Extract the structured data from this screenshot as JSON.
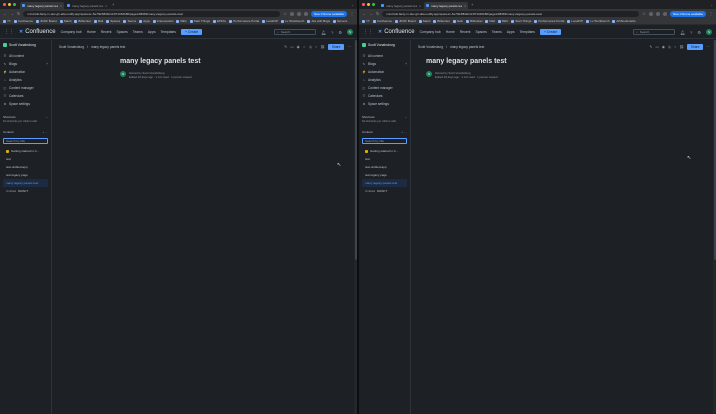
{
  "browser": {
    "tabs": [
      {
        "label": "many legacy panels test - C",
        "active": true
      },
      {
        "label": "many legacy panels test - C",
        "active": false
      }
    ],
    "new_tab_glyph": "+",
    "url": "mzuzwkl-facty-rv-dev-gh-atla.netlify.app/spaces/~5e7f9c8849c113f71040b80/pages/98369/many+legacy+panels+test",
    "new_chrome_label": "New Chrome available",
    "bookmarks": [
      "YT",
      "Confluence",
      "JDOF Board",
      "Stash",
      "Bitbucket",
      "Mail",
      "Spaces",
      "Teams",
      "Apps",
      "Frameworks",
      "REC",
      "Start Things",
      "EPFAL",
      "Performance Portal",
      "Local/VP",
      "Lv Workbench",
      "Jira with Bugs",
      "Servers"
    ],
    "bookmarks_right": [
      "Bitbucket",
      "hello",
      "All Bookmarks"
    ],
    "traffic": [
      "#ff5f57",
      "#febc2e",
      "#28c840"
    ]
  },
  "confluence": {
    "brand": "Confluence",
    "nav": [
      "Company hub",
      "Home",
      "Recent",
      "Spaces",
      "Teams",
      "Apps",
      "Templates"
    ],
    "create_label": "+ Create",
    "search_placeholder": "Search",
    "avatar_initial": "S"
  },
  "sidebar": {
    "space_name": "Scott Vonahsburg",
    "items": [
      {
        "icon": "☰",
        "label": "All content"
      },
      {
        "icon": "✎",
        "label": "Blogs",
        "plus": "+"
      },
      {
        "icon": "⚡",
        "label": "Automation"
      },
      {
        "icon": "⌁",
        "label": "Analytics"
      },
      {
        "icon": "◫",
        "label": "Content manager"
      },
      {
        "icon": "☷",
        "label": "Calendars"
      },
      {
        "icon": "⚙",
        "label": "Space settings"
      }
    ],
    "shortcuts_label": "Shortcuts",
    "shortcuts_note": "No shortcuts yet. Click to add",
    "content_label": "Content",
    "content_tools": "+ ···",
    "search_placeholder": "Search by title",
    "tree": [
      {
        "label": "Getting started in C...",
        "emoji": true,
        "active": false
      },
      {
        "label": "test",
        "emoji": false,
        "active": false
      },
      {
        "label": "test-untitled-app",
        "emoji": false,
        "active": false
      },
      {
        "label": "test legacy page",
        "emoji": false,
        "active": false
      },
      {
        "label": "many legacy panels test",
        "emoji": false,
        "active": true
      },
      {
        "label": "Untitled",
        "suffix": "DRAFT",
        "emoji": false,
        "active": false
      }
    ]
  },
  "page": {
    "breadcrumb_space": "Scott Vonahsburg",
    "breadcrumb_sep": "/",
    "breadcrumb_page": "many legacy panels test",
    "publish_label": "Share",
    "title": "many legacy panels test",
    "owner_avatar": "S",
    "owner_line": "Owned by Scott Vonahsburg",
    "meta_line_left": "Edited 49 days ago · 1 min read · 1 person viewed",
    "meta_line_right": "Edited 49 days ago · 1 min read · 1 person viewed"
  },
  "colors": {
    "accent": "#579dff",
    "background": "#1d2125",
    "chrome_tab": "#35363a"
  }
}
